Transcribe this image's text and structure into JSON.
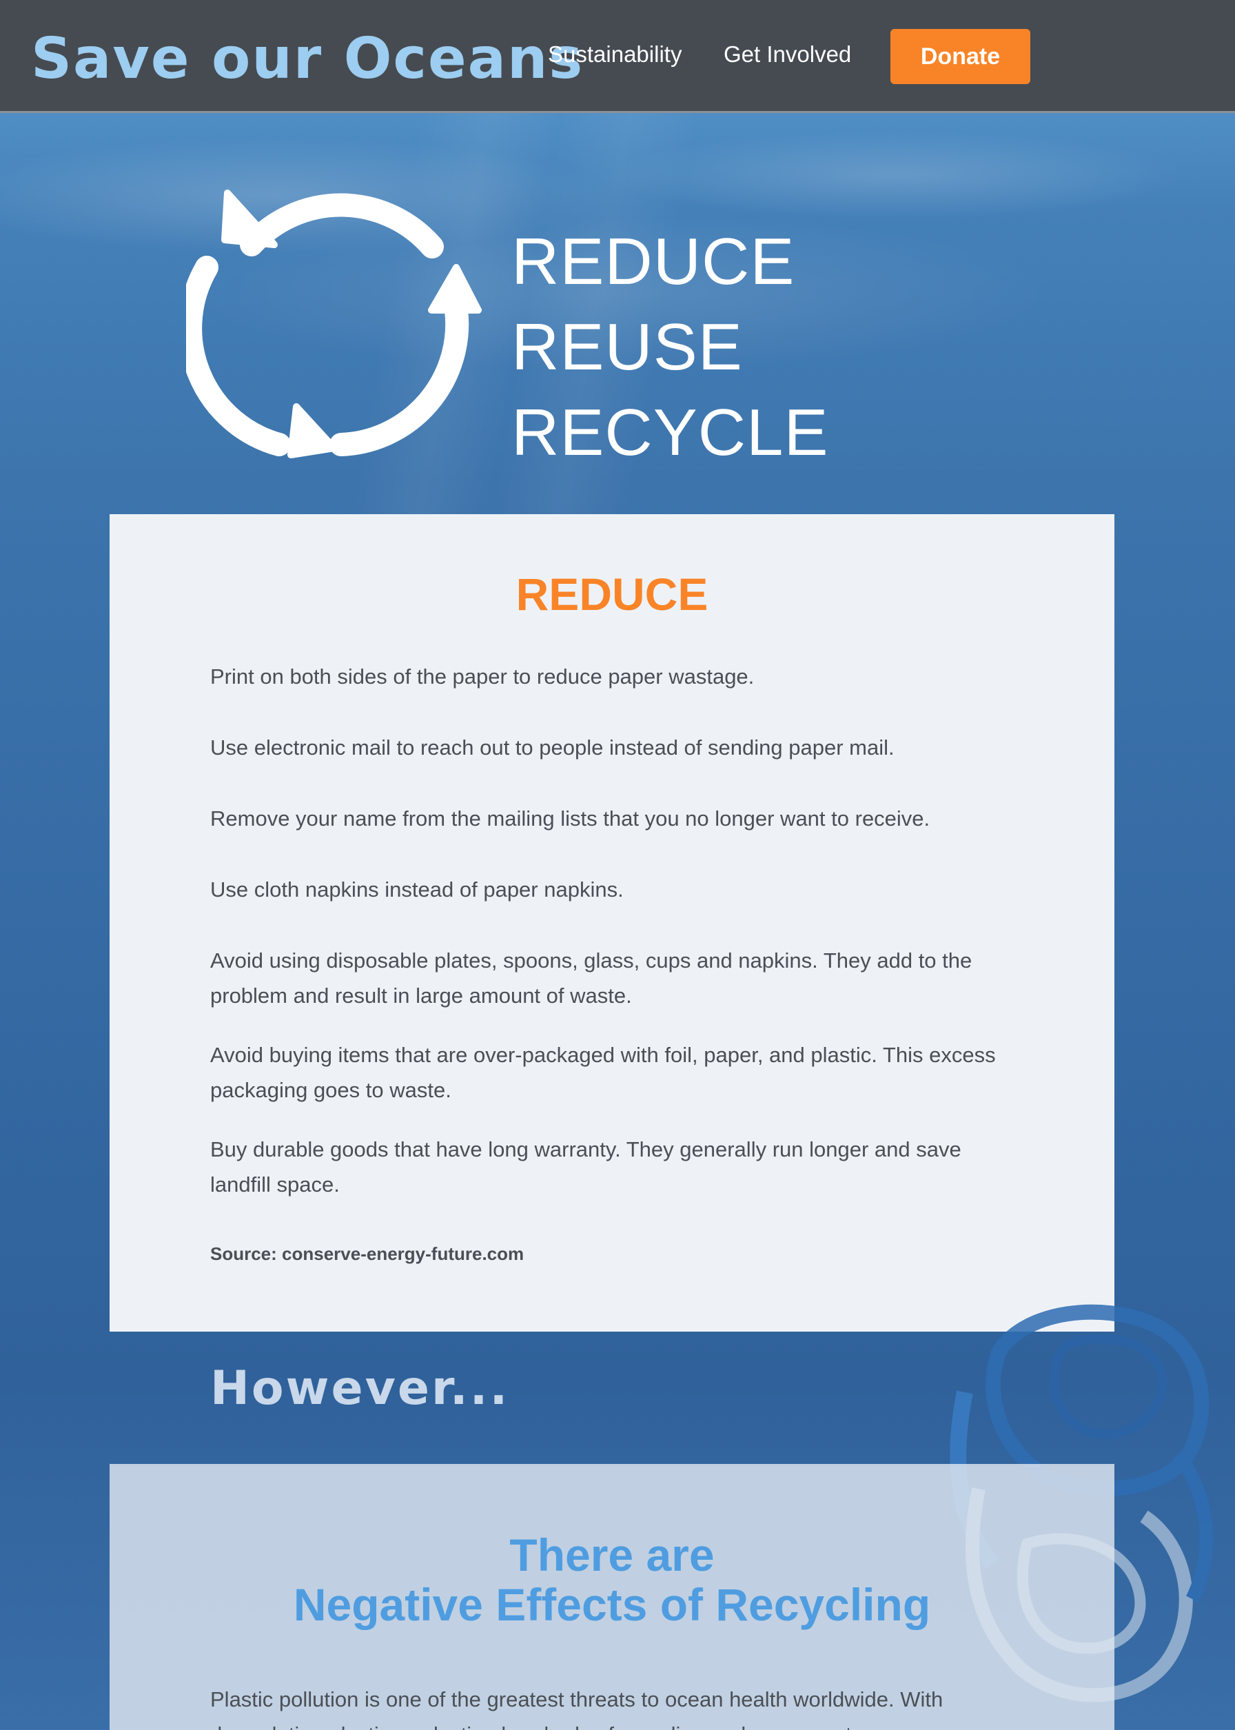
{
  "header": {
    "logo": "Save our Oceans",
    "nav": [
      {
        "label": "Sustainability"
      },
      {
        "label": "Get Involved"
      }
    ],
    "donate_label": "Donate"
  },
  "hero": {
    "words": [
      "REDUCE",
      "REUSE",
      "RECYCLE"
    ],
    "icon": "recycle-arrows-icon"
  },
  "reduce_card": {
    "title": "REDUCE",
    "tips": [
      "Print on both sides of the paper to reduce paper wastage.",
      "Use electronic mail to reach out to people instead of sending paper mail.",
      "Remove your name from the mailing lists that you no longer want to receive.",
      "Use cloth napkins instead of paper napkins.",
      "Avoid using disposable plates, spoons, glass, cups and napkins. They add to the problem and result in large amount of waste.",
      "Avoid buying items that are over-packaged with foil, paper, and plastic. This excess packaging goes to waste.",
      "Buy durable goods that have long warranty. They generally run longer and save landfill space."
    ],
    "source": "Source: conserve-energy-future.com"
  },
  "however": "However...",
  "negative_card": {
    "title_line1": "There are",
    "title_line2": "Negative Effects of Recycling",
    "body": "Plastic pollution is one of the greatest threats to ocean health worldwide. With degradation plastic production hundreds of recycling and movement"
  },
  "colors": {
    "header_bg": "#454b51",
    "logo": "#9dcdf0",
    "accent_orange": "#f98427",
    "heading_blue": "#4f9de0",
    "card_bg": "#eef2f7"
  }
}
